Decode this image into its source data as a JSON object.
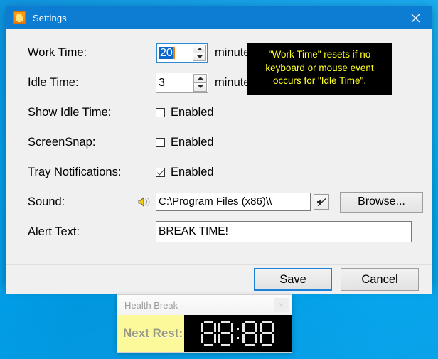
{
  "desktop": {
    "background_color": "#00a8f0"
  },
  "settings_window": {
    "title": "Settings",
    "icon": "bell-icon",
    "close_label": "✕",
    "accent_color": "#0d7dd4",
    "rows": {
      "work_time": {
        "label": "Work Time:",
        "value": "20",
        "unit": "minutes",
        "focused": true,
        "selected": true
      },
      "idle_time": {
        "label": "Idle Time:",
        "value": "3",
        "unit": "minutes",
        "focused": false,
        "selected": false
      },
      "show_idle_time": {
        "label": "Show Idle Time:",
        "checkbox_label": "Enabled",
        "checked": false
      },
      "screensnap": {
        "label": "ScreenSnap:",
        "checkbox_label": "Enabled",
        "checked": false
      },
      "tray_notifications": {
        "label": "Tray Notifications:",
        "checkbox_label": "Enabled",
        "checked": true
      },
      "sound": {
        "label": "Sound:",
        "value": "C:\\Program Files (x86)\\\\",
        "speaker_icon": "speaker-icon",
        "mute_icon": "speaker-mute-icon",
        "browse_label": "Browse..."
      },
      "alert_text": {
        "label": "Alert Text:",
        "value": "BREAK TIME!"
      }
    },
    "tooltip": {
      "text": "\"Work Time\" resets if no keyboard or mouse event occurs for \"Idle Time\".",
      "text_color": "#ffff22",
      "background_color": "#000000"
    },
    "footer": {
      "save_label": "Save",
      "cancel_label": "Cancel",
      "default_button": "Save",
      "focus_color": "#1a82d8"
    }
  },
  "health_widget": {
    "title": "Health Break",
    "close_label": "×",
    "rest_label": "Next Rest:",
    "label_background": "#fcf99a",
    "lcd_background": "#000000",
    "lcd_segment_color": "#e8e8e8",
    "display_time": "88:88",
    "digits": [
      "8",
      "8",
      "8",
      "8"
    ],
    "separator": ":"
  }
}
